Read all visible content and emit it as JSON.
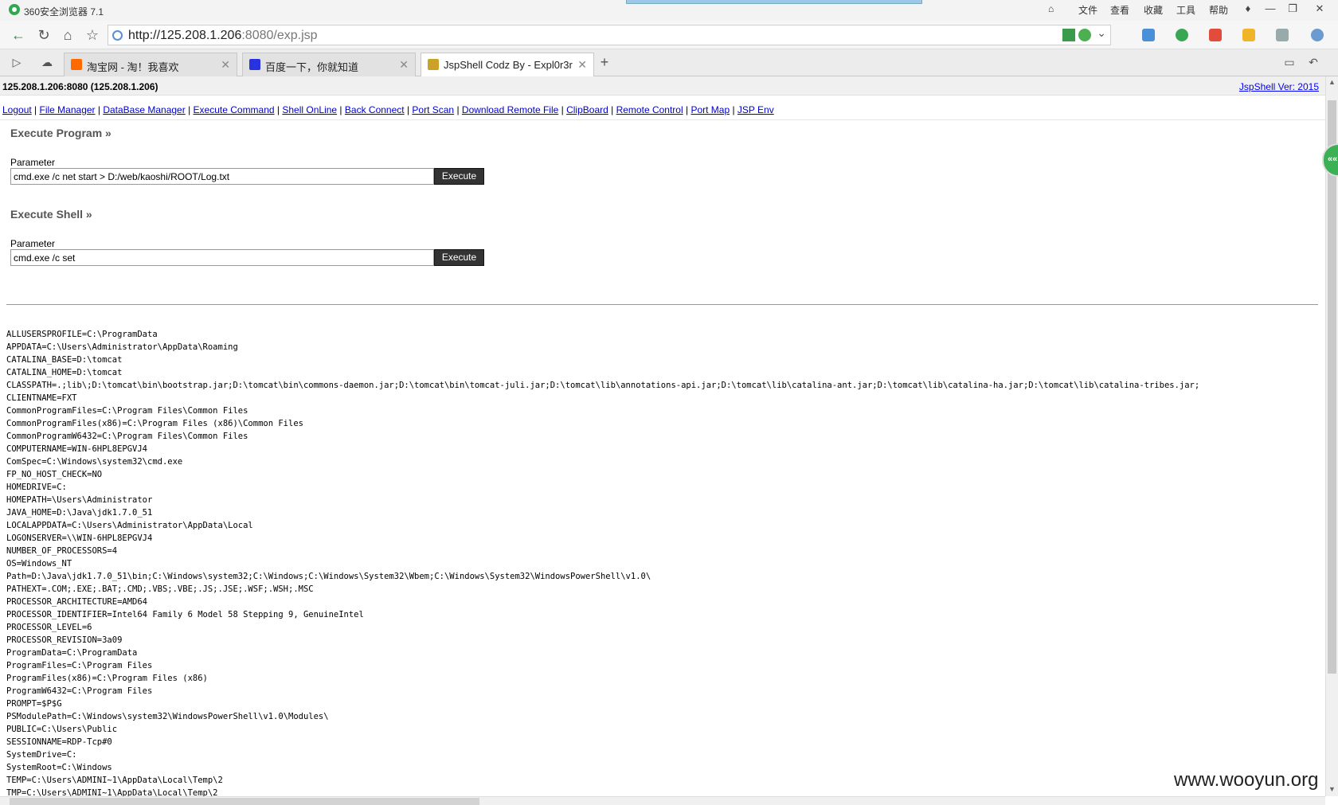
{
  "titlebar": {
    "app_title": "360安全浏览器 7.1",
    "menu": [
      "文件",
      "查看",
      "收藏",
      "工具",
      "帮助"
    ]
  },
  "address": {
    "host": "http://125.208.1.206",
    "rest": ":8080/exp.jsp"
  },
  "tabs": [
    {
      "label": "淘宝网 - 淘！我喜欢",
      "fav_color": "#ff6a00"
    },
    {
      "label": "百度一下，你就知道",
      "fav_color": "#2932e1"
    },
    {
      "label": "JspShell Codz By - Expl0r3r",
      "fav_color": "#c9a227"
    }
  ],
  "page": {
    "host_info": "125.208.1.206:8080 (125.208.1.206)",
    "version": "JspShell Ver: 2015",
    "nav": [
      "Logout",
      "File Manager",
      "DataBase Manager",
      "Execute Command",
      "Shell OnLine",
      "Back Connect",
      "Port Scan",
      "Download Remote File",
      "ClipBoard",
      "Remote Control",
      "Port Map",
      "JSP Env"
    ],
    "program": {
      "title": "Execute Program »",
      "param_label": "Parameter",
      "value": "cmd.exe /c net start > D:/web/kaoshi/ROOT/Log.txt",
      "button": "Execute"
    },
    "shell": {
      "title": "Execute Shell »",
      "param_label": "Parameter",
      "value": "cmd.exe /c set",
      "button": "Execute"
    },
    "output": "ALLUSERSPROFILE=C:\\ProgramData\nAPPDATA=C:\\Users\\Administrator\\AppData\\Roaming\nCATALINA_BASE=D:\\tomcat\nCATALINA_HOME=D:\\tomcat\nCLASSPATH=.;lib\\;D:\\tomcat\\bin\\bootstrap.jar;D:\\tomcat\\bin\\commons-daemon.jar;D:\\tomcat\\bin\\tomcat-juli.jar;D:\\tomcat\\lib\\annotations-api.jar;D:\\tomcat\\lib\\catalina-ant.jar;D:\\tomcat\\lib\\catalina-ha.jar;D:\\tomcat\\lib\\catalina-tribes.jar;\nCLIENTNAME=FXT\nCommonProgramFiles=C:\\Program Files\\Common Files\nCommonProgramFiles(x86)=C:\\Program Files (x86)\\Common Files\nCommonProgramW6432=C:\\Program Files\\Common Files\nCOMPUTERNAME=WIN-6HPL8EPGVJ4\nComSpec=C:\\Windows\\system32\\cmd.exe\nFP_NO_HOST_CHECK=NO\nHOMEDRIVE=C:\nHOMEPATH=\\Users\\Administrator\nJAVA_HOME=D:\\Java\\jdk1.7.0_51\nLOCALAPPDATA=C:\\Users\\Administrator\\AppData\\Local\nLOGONSERVER=\\\\WIN-6HPL8EPGVJ4\nNUMBER_OF_PROCESSORS=4\nOS=Windows_NT\nPath=D:\\Java\\jdk1.7.0_51\\bin;C:\\Windows\\system32;C:\\Windows;C:\\Windows\\System32\\Wbem;C:\\Windows\\System32\\WindowsPowerShell\\v1.0\\\nPATHEXT=.COM;.EXE;.BAT;.CMD;.VBS;.VBE;.JS;.JSE;.WSF;.WSH;.MSC\nPROCESSOR_ARCHITECTURE=AMD64\nPROCESSOR_IDENTIFIER=Intel64 Family 6 Model 58 Stepping 9, GenuineIntel\nPROCESSOR_LEVEL=6\nPROCESSOR_REVISION=3a09\nProgramData=C:\\ProgramData\nProgramFiles=C:\\Program Files\nProgramFiles(x86)=C:\\Program Files (x86)\nProgramW6432=C:\\Program Files\nPROMPT=$P$G\nPSModulePath=C:\\Windows\\system32\\WindowsPowerShell\\v1.0\\Modules\\\nPUBLIC=C:\\Users\\Public\nSESSIONNAME=RDP-Tcp#0\nSystemDrive=C:\nSystemRoot=C:\\Windows\nTEMP=C:\\Users\\ADMINI~1\\AppData\\Local\\Temp\\2\nTMP=C:\\Users\\ADMINI~1\\AppData\\Local\\Temp\\2"
  },
  "watermark": "www.wooyun.org",
  "colors": {
    "link": "#0000cc",
    "button_bg": "#333333",
    "accent_green": "#3cb054"
  }
}
